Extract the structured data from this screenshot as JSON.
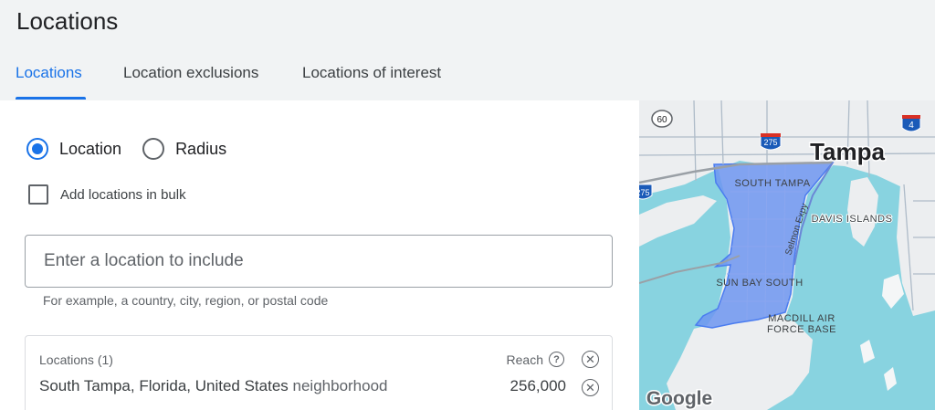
{
  "page": {
    "title": "Locations"
  },
  "tabs": [
    {
      "label": "Locations",
      "active": true
    },
    {
      "label": "Location exclusions",
      "active": false
    },
    {
      "label": "Locations of interest",
      "active": false
    }
  ],
  "targeting_mode": {
    "options": [
      {
        "label": "Location",
        "selected": true
      },
      {
        "label": "Radius",
        "selected": false
      }
    ]
  },
  "bulk": {
    "label": "Add locations in bulk",
    "checked": false
  },
  "search": {
    "placeholder": "Enter a location to include",
    "value": "",
    "helper": "For example, a country, city, region, or postal code"
  },
  "locations": {
    "header": "Locations (1)",
    "reach_label": "Reach",
    "items": [
      {
        "name": "South Tampa, Florida, United States",
        "type": "neighborhood",
        "reach": "256,000"
      }
    ]
  },
  "map": {
    "city_label": "Tampa",
    "area_labels": [
      "SOUTH TAMPA",
      "DAVIS ISLANDS",
      "SUN BAY SOUTH",
      "MACDILL AIR",
      "FORCE BASE"
    ],
    "road_label": "Selmon Expy",
    "shields": [
      "60",
      "275",
      "4",
      "275"
    ],
    "attribution": "Google",
    "colors": {
      "water": "#88d3e0",
      "land": "#eceef0",
      "highlight": "#6f95f0",
      "border": "#4a7cf0"
    }
  },
  "colors": {
    "accent": "#1a73e8",
    "background": "#f1f3f4"
  }
}
